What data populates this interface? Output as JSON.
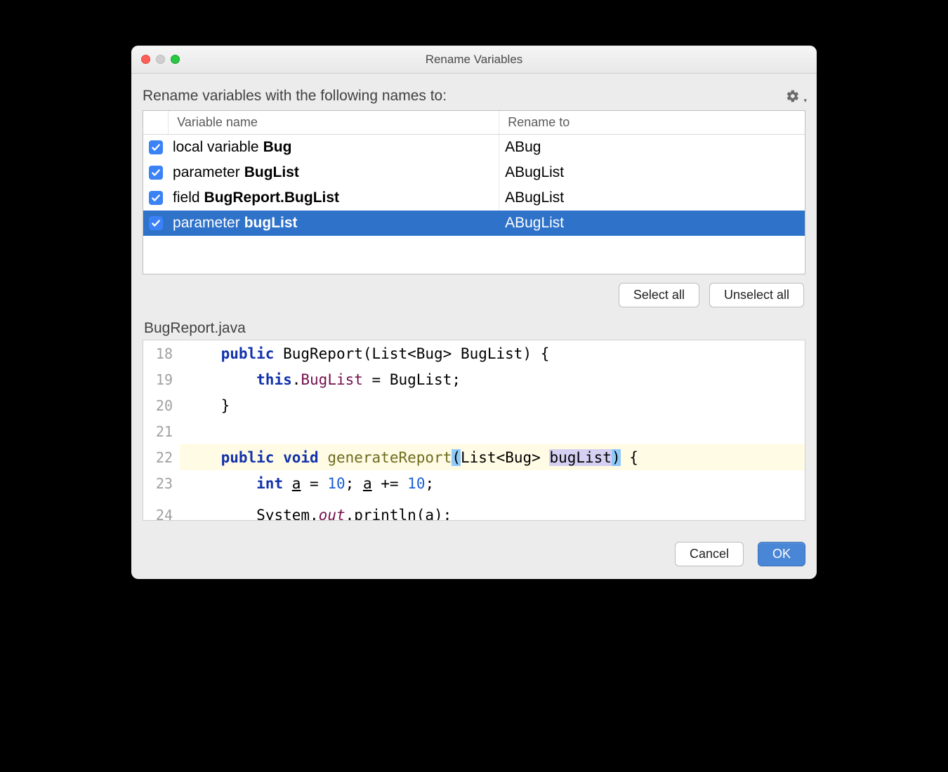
{
  "window": {
    "title": "Rename Variables"
  },
  "subheading": "Rename variables with the following names to:",
  "table": {
    "headers": {
      "col2": "Variable name",
      "col3": "Rename to"
    },
    "rows": [
      {
        "checked": true,
        "kind": "local variable",
        "name": "Bug",
        "rename_to": "ABug",
        "selected": false
      },
      {
        "checked": true,
        "kind": "parameter",
        "name": "BugList",
        "rename_to": "ABugList",
        "selected": false
      },
      {
        "checked": true,
        "kind": "field",
        "name": "BugReport.BugList",
        "rename_to": "ABugList",
        "selected": false
      },
      {
        "checked": true,
        "kind": "parameter",
        "name": "bugList",
        "rename_to": "ABugList",
        "selected": true
      }
    ]
  },
  "buttons": {
    "select_all": "Select all",
    "unselect_all": "Unselect all",
    "cancel": "Cancel",
    "ok": "OK"
  },
  "file_label": "BugReport.java",
  "code": {
    "lines": [
      {
        "n": 18,
        "indent": "    ",
        "tokens": [
          {
            "t": "public",
            "c": "kw"
          },
          {
            "t": " BugReport(List<Bug> BugList) {"
          }
        ]
      },
      {
        "n": 19,
        "indent": "        ",
        "tokens": [
          {
            "t": "this",
            "c": "kw"
          },
          {
            "t": "."
          },
          {
            "t": "BugList",
            "c": "field"
          },
          {
            "t": " = BugList;"
          }
        ]
      },
      {
        "n": 20,
        "indent": "    ",
        "tokens": [
          {
            "t": "}"
          }
        ]
      },
      {
        "n": 21,
        "indent": "",
        "tokens": []
      },
      {
        "n": 22,
        "indent": "    ",
        "hl": true,
        "tokens": [
          {
            "t": "public",
            "c": "kw"
          },
          {
            "t": " "
          },
          {
            "t": "void",
            "c": "kw"
          },
          {
            "t": " "
          },
          {
            "t": "generateReport",
            "c": "fn"
          },
          {
            "t": "(",
            "c": "paren-hi"
          },
          {
            "t": "List<Bug> "
          },
          {
            "t": "bugList",
            "c": "param-hi"
          },
          {
            "t": ")",
            "c": "paren-hi"
          },
          {
            "t": " {"
          }
        ]
      },
      {
        "n": 23,
        "indent": "        ",
        "tokens": [
          {
            "t": "int",
            "c": "kw"
          },
          {
            "t": " "
          },
          {
            "t": "a",
            "c": "underline"
          },
          {
            "t": " = "
          },
          {
            "t": "10",
            "c": "num"
          },
          {
            "t": "; "
          },
          {
            "t": "a",
            "c": "underline"
          },
          {
            "t": " += "
          },
          {
            "t": "10",
            "c": "num"
          },
          {
            "t": ";"
          }
        ]
      },
      {
        "n": 24,
        "indent": "        ",
        "cut": true,
        "tokens": [
          {
            "t": "System."
          },
          {
            "t": "out",
            "c": "staticf"
          },
          {
            "t": ".println(a);"
          }
        ]
      }
    ]
  }
}
